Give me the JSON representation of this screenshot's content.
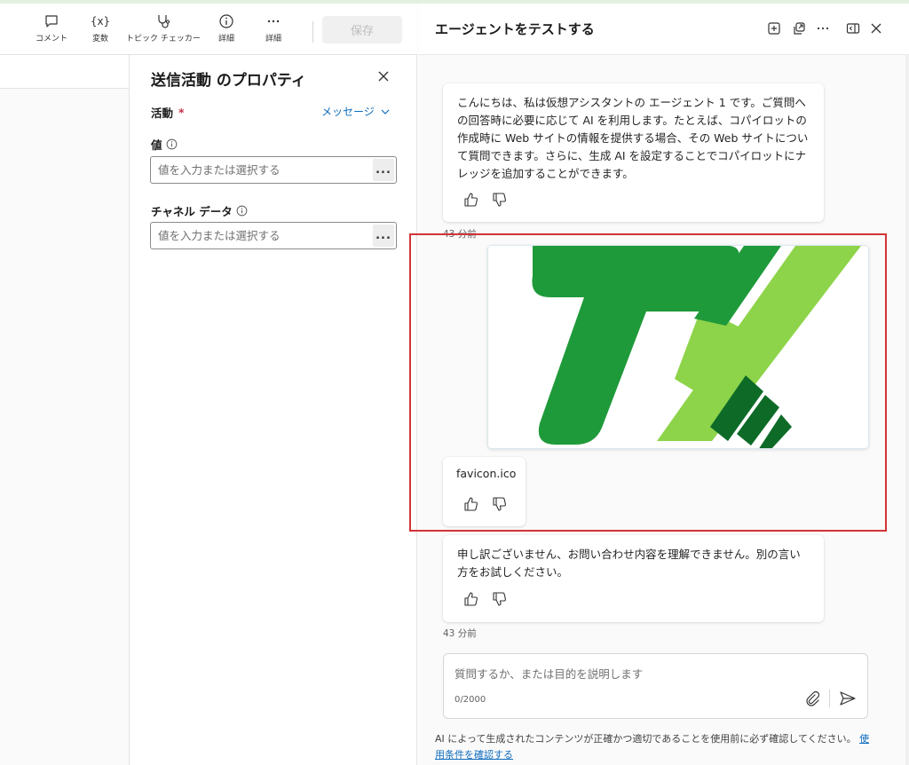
{
  "toolbar": {
    "comment_label": "コメント",
    "variables_label": "変数",
    "topic_checker_label": "トピック チェッカー",
    "details_label": "詳細",
    "more_label": "詳細",
    "save_label": "保存"
  },
  "properties": {
    "title": "送信活動 のプロパティ",
    "activity_label": "活動",
    "required_mark": "*",
    "activity_value": "メッセージ",
    "value_label": "値",
    "value_placeholder": "値を入力または選択する",
    "channel_label": "チャネル データ",
    "channel_placeholder": "値を入力または選択する",
    "more_button": "..."
  },
  "test_pane": {
    "title": "エージェントをテストする",
    "messages": [
      {
        "text": "こんにちは、私は仮想アシスタントの エージェント 1 です。ご質問への回答時に必要に応じて AI を利用します。たとえば、コパイロットの作成時に Web サイトの情報を提供する場合、その Web サイトについて質問できます。さらに、生成 AI を設定することでコパイロットにナレッジを追加することができます。",
        "time": "43 分前"
      },
      {
        "attachment_name": "favicon.ico"
      },
      {
        "text": "申し訳ございません、お問い合わせ内容を理解できません。別の言い方をお試しください。",
        "time": "43 分前"
      }
    ],
    "composer_placeholder": "質問するか、または目的を説明します",
    "char_counter": "0/2000",
    "disclaimer": "AI によって生成されたコンテンツが正確かつ適切であることを使用前に必ず確認してください。",
    "disclaimer_link": "使用条件を確認する"
  },
  "colors": {
    "accent": "#0f6cbd",
    "highlight_box": "#d13438",
    "logo_dark_green": "#1f9a3a",
    "logo_light_green": "#8dd44a",
    "logo_darkest_green": "#0d6b27"
  },
  "icons": [
    "comment-icon",
    "variable-icon",
    "stethoscope-icon",
    "info-icon",
    "ellipsis-icon",
    "close-icon",
    "chevron-down-icon",
    "new-chat-icon",
    "share-icon",
    "panel-icon",
    "thumbs-up-icon",
    "thumbs-down-icon",
    "paperclip-icon",
    "send-icon"
  ]
}
